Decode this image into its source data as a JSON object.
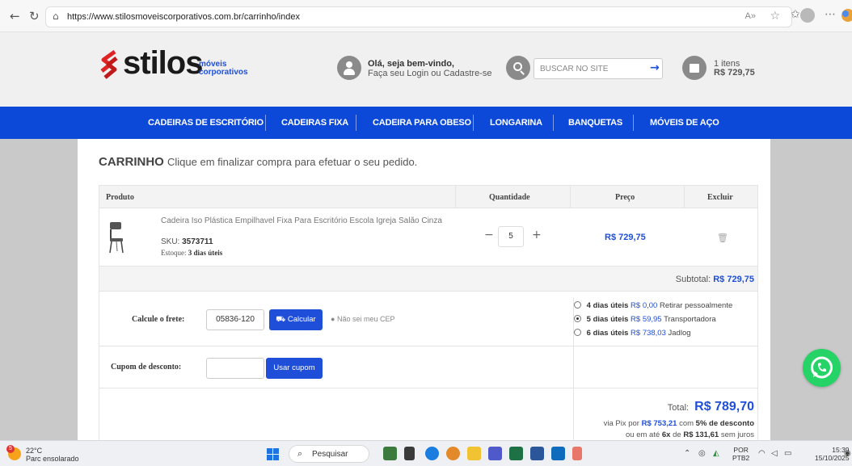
{
  "browser": {
    "url": "https://www.stilosmoveiscorporativos.com.br/carrinho/index",
    "back_icon": "back-arrow-icon",
    "reload_icon": "reload-icon"
  },
  "header": {
    "logo_word": "stilos",
    "logo_sub1": "móveis",
    "logo_sub2": "corporativos",
    "welcome_line1": "Olá, seja bem-vindo,",
    "welcome_line2": "Faça seu Login ou Cadastre-se",
    "search_placeholder": "BUSCAR NO SITE",
    "cart_items": "1 itens",
    "cart_total": "R$ 729,75"
  },
  "nav": {
    "items": [
      "CADEIRAS DE ESCRITÓRIO",
      "CADEIRAS FIXA",
      "CADEIRA PARA OBESO",
      "LONGARINA",
      "BANQUETAS",
      "MÓVEIS DE AÇO"
    ]
  },
  "cart": {
    "title": "CARRINHO",
    "subtitle": "Clique em finalizar compra para efetuar o seu pedido.",
    "headers": {
      "product": "Produto",
      "quantity": "Quantidade",
      "price": "Preço",
      "remove": "Excluir"
    },
    "item": {
      "name": "Cadeira Iso Plástica Empilhavel Fixa Para Escritório Escola Igreja Salão Cinza",
      "sku_label": "SKU:",
      "sku": "3573711",
      "stock_label": "Estoque:",
      "stock": "3 dias úteis",
      "quantity": "5",
      "price": "R$ 729,75"
    },
    "subtotal_label": "Subtotal:",
    "subtotal": "R$ 729,75",
    "shipping": {
      "label": "Calcule o frete:",
      "cep": "05836-120",
      "button": "Calcular",
      "dont_know": "Não sei meu CEP",
      "options": [
        {
          "days": "4 dias úteis",
          "price": "R$ 0,00",
          "carrier": "Retirar pessoalmente",
          "selected": false
        },
        {
          "days": "5 dias úteis",
          "price": "R$ 59,95",
          "carrier": "Transportadora",
          "selected": true
        },
        {
          "days": "6 dias úteis",
          "price": "R$ 738,03",
          "carrier": "Jadlog",
          "selected": false
        }
      ]
    },
    "coupon": {
      "label": "Cupom de desconto:",
      "button": "Usar cupom"
    },
    "total_label": "Total:",
    "total": "R$ 789,70",
    "pix_prefix": "via Pix por",
    "pix_value": "R$ 753,21",
    "pix_mid": "com",
    "pix_discount": "5% de desconto",
    "installment_prefix": "ou em até",
    "installment_count": "6x",
    "installment_mid": "de",
    "installment_value": "R$ 131,61",
    "installment_suffix": "sem juros"
  },
  "taskbar": {
    "temp": "22°C",
    "weather": "Parc ensolarado",
    "weather_badge": "5",
    "search": "Pesquisar",
    "lang1": "POR",
    "lang2": "PTB2",
    "time": "15:39",
    "date": "15/10/2025"
  },
  "colors": {
    "brand_blue": "#0c49d8",
    "price_blue": "#1f4fd8",
    "whatsapp_green": "#25d366",
    "logo_red": "#e02424"
  }
}
